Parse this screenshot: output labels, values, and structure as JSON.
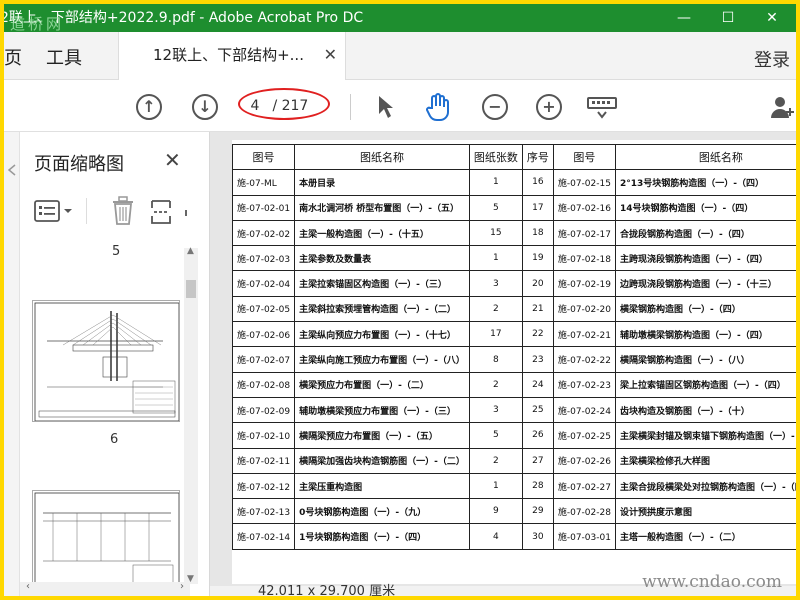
{
  "window": {
    "title": "2联上、下部结构+2022.9.pdf - Adobe Acrobat Pro DC",
    "watermark": "道桥网",
    "min": "—",
    "max": "☐",
    "close": "✕"
  },
  "tabs": {
    "home_partial": "页",
    "tools": "工具",
    "document": "12联上、下部结构+...",
    "login": "登录"
  },
  "toolbar": {
    "current_page": "4",
    "total_pages": "/ 217"
  },
  "sidebar": {
    "title": "页面缩略图",
    "thumb_label_top": "5",
    "thumb_label": "6"
  },
  "table": {
    "headers": [
      "图号",
      "图纸名称",
      "图纸张数",
      "序号",
      "图号",
      "图纸名称"
    ],
    "rows": [
      [
        "施-07-ML",
        "本册目录",
        "1",
        "16",
        "施-07-02-15",
        "2°13号块钢筋构造图（一）-（四）"
      ],
      [
        "施-07-02-01",
        "南水北调河桥 桥型布置图（一）-（五）",
        "5",
        "17",
        "施-07-02-16",
        "14号块钢筋构造图（一）-（四）"
      ],
      [
        "施-07-02-02",
        "主梁一般构造图（一）-（十五）",
        "15",
        "18",
        "施-07-02-17",
        "合拢段钢筋构造图（一）-（四）"
      ],
      [
        "施-07-02-03",
        "主梁参数及数量表",
        "1",
        "19",
        "施-07-02-18",
        "主跨现浇段钢筋构造图（一）-（四）"
      ],
      [
        "施-07-02-04",
        "主梁拉索锚固区构造图（一）-（三）",
        "3",
        "20",
        "施-07-02-19",
        "边跨现浇段钢筋构造图（一）-（十三）"
      ],
      [
        "施-07-02-05",
        "主梁斜拉索预埋管构造图（一）-（二）",
        "2",
        "21",
        "施-07-02-20",
        "横梁钢筋构造图（一）-（四）"
      ],
      [
        "施-07-02-06",
        "主梁纵向预应力布置图（一）-（十七）",
        "17",
        "22",
        "施-07-02-21",
        "辅助墩横梁钢筋构造图（一）-（四）"
      ],
      [
        "施-07-02-07",
        "主梁纵向施工预应力布置图（一）-（八）",
        "8",
        "23",
        "施-07-02-22",
        "横隔梁钢筋构造图（一）-（八）"
      ],
      [
        "施-07-02-08",
        "横梁预应力布置图（一）-（二）",
        "2",
        "24",
        "施-07-02-23",
        "梁上拉索锚固区钢筋构造图（一）-（四）"
      ],
      [
        "施-07-02-09",
        "辅助墩横梁预应力布置图（一）-（三）",
        "3",
        "25",
        "施-07-02-24",
        "齿块构造及钢筋图（一）-（十）"
      ],
      [
        "施-07-02-10",
        "横隔梁预应力布置图（一）-（五）",
        "5",
        "26",
        "施-07-02-25",
        "主梁横梁封锚及钢束锚下钢筋构造图（一）-（四）"
      ],
      [
        "施-07-02-11",
        "横隔梁加强齿块构造钢筋图（一）-（二）",
        "2",
        "27",
        "施-07-02-26",
        "主梁横梁检修孔大样图"
      ],
      [
        "施-07-02-12",
        "主梁压重构造图",
        "1",
        "28",
        "施-07-02-27",
        "主梁合拢段横梁处对拉钢筋构造图（一）-（四）"
      ],
      [
        "施-07-02-13",
        "0号块钢筋构造图（一）-（九）",
        "9",
        "29",
        "施-07-02-28",
        "设计预拱度示意图"
      ],
      [
        "施-07-02-14",
        "1号块钢筋构造图（一）-（四）",
        "4",
        "30",
        "施-07-03-01",
        "主塔一般构造图（一）-（二）"
      ]
    ]
  },
  "status": {
    "page_size": "42.011 x 29.700 厘米"
  },
  "site_watermark": "www.cndao.com"
}
